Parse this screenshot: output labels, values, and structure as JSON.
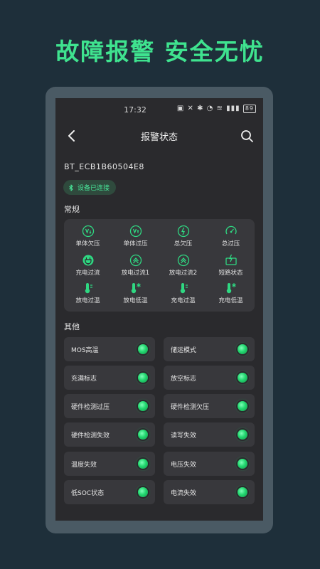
{
  "banner": {
    "title": "故障报警 安全无忧"
  },
  "statusbar": {
    "time": "17:32",
    "icons": "▣ ✕ ✱ ◔ ≋ ▮▮▮",
    "battery": "89"
  },
  "header": {
    "title": "报警状态",
    "back_icon": "chevron-left-icon",
    "search_icon": "search-icon"
  },
  "device": {
    "name": "BT_ECB1B60504E8",
    "status": "设备已连接"
  },
  "colors": {
    "accent": "#3fe38f",
    "background": "#1e2f3a",
    "card": "#38383c"
  },
  "regular": {
    "title": "常规",
    "items": [
      {
        "label": "单体欠压",
        "icon": "cell-undervoltage-icon"
      },
      {
        "label": "单体过压",
        "icon": "cell-overvoltage-icon"
      },
      {
        "label": "总欠压",
        "icon": "total-undervoltage-icon"
      },
      {
        "label": "总过压",
        "icon": "total-overvoltage-icon"
      },
      {
        "label": "充电过流",
        "icon": "charge-overcurrent-icon"
      },
      {
        "label": "放电过流1",
        "icon": "discharge-overcurrent-icon"
      },
      {
        "label": "放电过流2",
        "icon": "discharge-overcurrent-icon"
      },
      {
        "label": "短路状态",
        "icon": "short-circuit-icon"
      },
      {
        "label": "放电过温",
        "icon": "thermometer-hot-icon"
      },
      {
        "label": "放电低温",
        "icon": "thermometer-cold-icon"
      },
      {
        "label": "充电过温",
        "icon": "thermometer-hot-icon"
      },
      {
        "label": "充电低温",
        "icon": "thermometer-cold-icon"
      }
    ]
  },
  "other": {
    "title": "其他",
    "items": [
      {
        "label": "MOS高温"
      },
      {
        "label": "储运模式"
      },
      {
        "label": "充满标志"
      },
      {
        "label": "放空标志"
      },
      {
        "label": "硬件检测过压"
      },
      {
        "label": "硬件检测欠压"
      },
      {
        "label": "硬件检测失效"
      },
      {
        "label": "读写失效"
      },
      {
        "label": "温度失效"
      },
      {
        "label": "电压失效"
      },
      {
        "label": "低SOC状态"
      },
      {
        "label": "电流失效"
      }
    ]
  }
}
